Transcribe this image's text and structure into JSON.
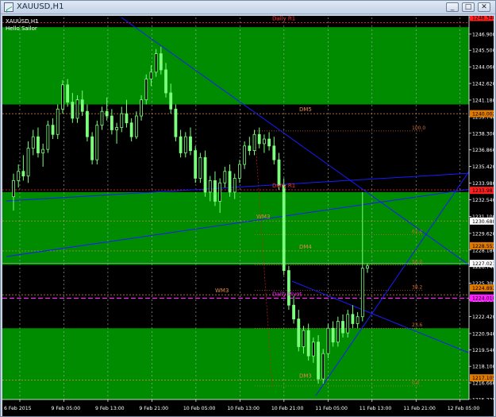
{
  "window": {
    "title": "XAUUSD,H1",
    "buttons": [
      "_",
      "□",
      "✕"
    ]
  },
  "chart": {
    "symbol_label": "XAUUSD,H1",
    "indicator_label": "Hello Sailor",
    "colors": {
      "background": "#000000",
      "zone_green": "#008c00",
      "candle": "#7cff7c",
      "trendline": "#1a1aff",
      "grid": "#b0b0b0",
      "axis_text": "#000000",
      "price_box_red": "#ff2020",
      "price_box_orange": "#e07a00",
      "pivot_magenta": "#ff20ff",
      "fib_orange": "#d26a2a"
    },
    "zones": [
      {
        "name": "upper-green",
        "from": 1247.5,
        "to": 1240.8
      },
      {
        "name": "middle-green",
        "from": 1233.2,
        "to": 1226.9
      },
      {
        "name": "lower-green",
        "from": 1221.4,
        "to": 1215.0
      }
    ],
    "levels": [
      {
        "label": "Daily R1",
        "price": 1247.9,
        "color": "#ff3030"
      },
      {
        "label": "DM5",
        "price": 1240.0,
        "color": "#e08a4a"
      },
      {
        "label": "Daily R1",
        "price": 1233.4,
        "color": "#ff3030"
      },
      {
        "label": "WM3",
        "price": 1230.7,
        "color": "#e08a4a"
      },
      {
        "label": "DM4",
        "price": 1228.1,
        "color": "#e08a4a"
      },
      {
        "label": "WM3",
        "price": 1224.3,
        "color": "#e08a4a"
      },
      {
        "label": "Daily Pivot",
        "price": 1224.0,
        "color": "#ff20ff"
      },
      {
        "label": "DM3",
        "price": 1216.9,
        "color": "#e08a4a"
      }
    ],
    "fib_labels": [
      {
        "label": "100.0",
        "price": 1238.5
      },
      {
        "label": "61.8",
        "price": 1229.5
      },
      {
        "label": "50.0",
        "price": 1226.9
      },
      {
        "label": "38.2",
        "price": 1224.7
      },
      {
        "label": "23.6",
        "price": 1221.4
      },
      {
        "label": "0.0",
        "price": 1216.4
      }
    ],
    "price_axis": [
      "1248.340",
      "1246.900",
      "1245.500",
      "1244.060",
      "1242.620",
      "1241.180",
      "1239.740",
      "1238.300",
      "1236.860",
      "1235.420",
      "1233.980",
      "1232.540",
      "1231.100",
      "1229.620",
      "1228.180",
      "1226.740",
      "1225.300",
      "1223.860",
      "1222.420",
      "1220.940",
      "1219.540",
      "1218.100",
      "1216.660",
      "1215.220"
    ],
    "price_boxes": [
      {
        "text": "1248.340",
        "price": 1248.34,
        "color": "#ff2020"
      },
      {
        "text": "1240.002",
        "price": 1240.0,
        "color": "#e07a00"
      },
      {
        "text": "1233.981",
        "price": 1233.35,
        "color": "#ff2020"
      },
      {
        "text": "1230.688",
        "price": 1230.69,
        "color": "#ffffff"
      },
      {
        "text": "1228.553",
        "price": 1228.55,
        "color": "#e07a00"
      },
      {
        "text": "1227.021",
        "price": 1227.02,
        "color": "#ffffff"
      },
      {
        "text": "1224.892",
        "price": 1224.89,
        "color": "#e07a00"
      },
      {
        "text": "1224.018",
        "price": 1224.02,
        "color": "#ff20ff"
      },
      {
        "text": "1217.105",
        "price": 1217.1,
        "color": "#e07a00"
      }
    ],
    "time_axis": [
      "6 Feb 2015",
      "9 Feb 05:00",
      "9 Feb 13:00",
      "9 Feb 21:00",
      "10 Feb 05:00",
      "10 Feb 13:00",
      "10 Feb 21:00",
      "11 Feb 05:00",
      "11 Feb 13:00",
      "11 Feb 21:00",
      "12 Feb 05:00"
    ],
    "price_range": [
      1215.22,
      1248.34
    ],
    "candles": [
      [
        1232.8,
        1234.8,
        1231.6,
        1234.2
      ],
      [
        1234.2,
        1235.6,
        1233.6,
        1235.0
      ],
      [
        1235.0,
        1236.4,
        1234.2,
        1234.6
      ],
      [
        1234.6,
        1237.6,
        1234.0,
        1237.0
      ],
      [
        1237.0,
        1238.6,
        1236.4,
        1238.0
      ],
      [
        1238.0,
        1238.8,
        1236.2,
        1236.6
      ],
      [
        1236.6,
        1237.4,
        1235.4,
        1236.9
      ],
      [
        1236.9,
        1239.4,
        1236.6,
        1239.0
      ],
      [
        1239.0,
        1239.6,
        1237.8,
        1238.2
      ],
      [
        1238.2,
        1240.8,
        1237.8,
        1240.4
      ],
      [
        1240.4,
        1242.9,
        1240.0,
        1242.5
      ],
      [
        1242.5,
        1243.0,
        1240.6,
        1241.0
      ],
      [
        1241.0,
        1241.8,
        1239.2,
        1239.6
      ],
      [
        1239.6,
        1241.6,
        1239.2,
        1241.2
      ],
      [
        1241.2,
        1242.0,
        1239.8,
        1240.2
      ],
      [
        1240.2,
        1240.8,
        1237.6,
        1238.0
      ],
      [
        1238.0,
        1238.4,
        1235.6,
        1236.0
      ],
      [
        1236.0,
        1239.4,
        1235.6,
        1239.0
      ],
      [
        1239.0,
        1240.6,
        1238.6,
        1240.2
      ],
      [
        1240.2,
        1241.4,
        1239.4,
        1239.8
      ],
      [
        1239.8,
        1240.4,
        1238.2,
        1238.6
      ],
      [
        1238.6,
        1239.2,
        1237.4,
        1238.8
      ],
      [
        1238.8,
        1240.6,
        1238.4,
        1240.0
      ],
      [
        1240.0,
        1241.2,
        1238.8,
        1239.2
      ],
      [
        1239.2,
        1239.6,
        1237.6,
        1238.0
      ],
      [
        1238.0,
        1240.2,
        1237.8,
        1239.8
      ],
      [
        1239.8,
        1241.6,
        1239.4,
        1241.2
      ],
      [
        1241.2,
        1243.4,
        1240.8,
        1243.0
      ],
      [
        1243.0,
        1244.2,
        1242.4,
        1243.6
      ],
      [
        1243.6,
        1245.6,
        1243.2,
        1245.2
      ],
      [
        1245.2,
        1245.8,
        1243.4,
        1243.8
      ],
      [
        1243.8,
        1244.4,
        1241.4,
        1241.8
      ],
      [
        1241.8,
        1242.6,
        1240.0,
        1240.4
      ],
      [
        1240.4,
        1240.8,
        1237.6,
        1238.0
      ],
      [
        1238.0,
        1238.6,
        1236.2,
        1236.6
      ],
      [
        1236.6,
        1238.4,
        1236.2,
        1238.0
      ],
      [
        1238.0,
        1238.8,
        1236.4,
        1236.8
      ],
      [
        1236.8,
        1237.2,
        1234.0,
        1234.4
      ],
      [
        1234.4,
        1236.6,
        1234.0,
        1236.2
      ],
      [
        1236.2,
        1236.8,
        1232.8,
        1233.2
      ],
      [
        1233.2,
        1234.6,
        1232.4,
        1234.2
      ],
      [
        1234.2,
        1235.0,
        1232.0,
        1232.4
      ],
      [
        1232.4,
        1234.4,
        1231.4,
        1234.0
      ],
      [
        1234.0,
        1235.4,
        1233.6,
        1235.0
      ],
      [
        1235.0,
        1235.6,
        1232.8,
        1233.2
      ],
      [
        1233.2,
        1234.8,
        1232.6,
        1234.4
      ],
      [
        1234.4,
        1236.0,
        1234.0,
        1235.6
      ],
      [
        1235.6,
        1237.6,
        1235.2,
        1237.2
      ],
      [
        1237.2,
        1238.0,
        1236.4,
        1236.8
      ],
      [
        1236.8,
        1238.6,
        1236.4,
        1238.2
      ],
      [
        1238.2,
        1238.8,
        1237.0,
        1237.4
      ],
      [
        1237.4,
        1238.2,
        1236.6,
        1237.8
      ],
      [
        1237.8,
        1238.4,
        1236.8,
        1237.2
      ],
      [
        1237.2,
        1238.0,
        1235.6,
        1236.0
      ],
      [
        1236.0,
        1236.6,
        1233.4,
        1233.8
      ],
      [
        1233.8,
        1234.4,
        1226.0,
        1226.4
      ],
      [
        1226.4,
        1226.8,
        1223.0,
        1223.4
      ],
      [
        1223.4,
        1224.2,
        1221.8,
        1222.2
      ],
      [
        1222.2,
        1223.0,
        1219.4,
        1219.8
      ],
      [
        1219.8,
        1221.6,
        1219.2,
        1221.2
      ],
      [
        1221.2,
        1221.8,
        1218.6,
        1219.0
      ],
      [
        1219.0,
        1220.6,
        1218.4,
        1220.2
      ],
      [
        1220.2,
        1220.8,
        1216.6,
        1217.0
      ],
      [
        1217.0,
        1219.6,
        1216.6,
        1219.2
      ],
      [
        1219.2,
        1221.8,
        1218.8,
        1221.4
      ],
      [
        1221.4,
        1222.0,
        1219.8,
        1220.2
      ],
      [
        1220.2,
        1222.4,
        1219.8,
        1222.0
      ],
      [
        1222.0,
        1222.6,
        1220.6,
        1221.0
      ],
      [
        1221.0,
        1223.0,
        1220.6,
        1222.6
      ],
      [
        1222.6,
        1223.4,
        1221.4,
        1221.8
      ],
      [
        1221.8,
        1222.8,
        1221.4,
        1222.4
      ],
      [
        1222.4,
        1233.2,
        1222.0,
        1226.6
      ],
      [
        1226.6,
        1227.0,
        1226.2,
        1226.8
      ]
    ]
  }
}
